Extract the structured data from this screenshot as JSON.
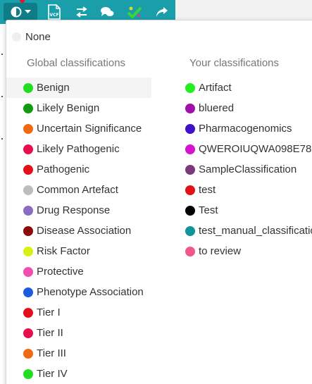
{
  "toolbar": {
    "buttons": [
      {
        "icon": "classification-icon",
        "has_dropdown": true
      },
      {
        "icon": "vcf-file-icon",
        "label": "VCF"
      },
      {
        "icon": "swap-arrows-icon"
      },
      {
        "icon": "comments-icon"
      },
      {
        "icon": "green-check-icon"
      },
      {
        "icon": "share-forward-icon"
      }
    ],
    "background_color": "#1a9eaa",
    "active_color": "#0f7d87"
  },
  "dropdown": {
    "none_label": "None",
    "global_heading": "Global classifications",
    "yours_heading": "Your classifications",
    "global_items": [
      {
        "label": "Benign",
        "color": "#22dd22"
      },
      {
        "label": "Likely Benign",
        "color": "#119911"
      },
      {
        "label": "Uncertain Significance",
        "color": "#f06a12"
      },
      {
        "label": "Likely Pathogenic",
        "color": "#e8104c"
      },
      {
        "label": "Pathogenic",
        "color": "#e3101a"
      },
      {
        "label": "Common Artefact",
        "color": "#bdbdbd"
      },
      {
        "label": "Drug Response",
        "color": "#8b6cc4"
      },
      {
        "label": "Disease Association",
        "color": "#8a0a0a"
      },
      {
        "label": "Risk Factor",
        "color": "#d8f012"
      },
      {
        "label": "Protective",
        "color": "#f04fb0"
      },
      {
        "label": "Phenotype Association",
        "color": "#1c5de0"
      },
      {
        "label": "Tier I",
        "color": "#e3101a"
      },
      {
        "label": "Tier II",
        "color": "#e8104c"
      },
      {
        "label": "Tier III",
        "color": "#f06a12"
      },
      {
        "label": "Tier IV",
        "color": "#22dd22"
      }
    ],
    "your_items": [
      {
        "label": "Artifact",
        "color": "#22ee22"
      },
      {
        "label": "bluered",
        "color": "#a010a8"
      },
      {
        "label": "Pharmacogenomics",
        "color": "#4010c8"
      },
      {
        "label": "QWEROIUQWA098E78",
        "color": "#d810d0"
      },
      {
        "label": "SampleClassification",
        "color": "#7a3a7a"
      },
      {
        "label": "test",
        "color": "#e3101a"
      },
      {
        "label": "Test",
        "color": "#000000"
      },
      {
        "label": "test_manual_classification",
        "color": "#10939a"
      },
      {
        "label": "to review",
        "color": "#f0588a"
      }
    ]
  }
}
